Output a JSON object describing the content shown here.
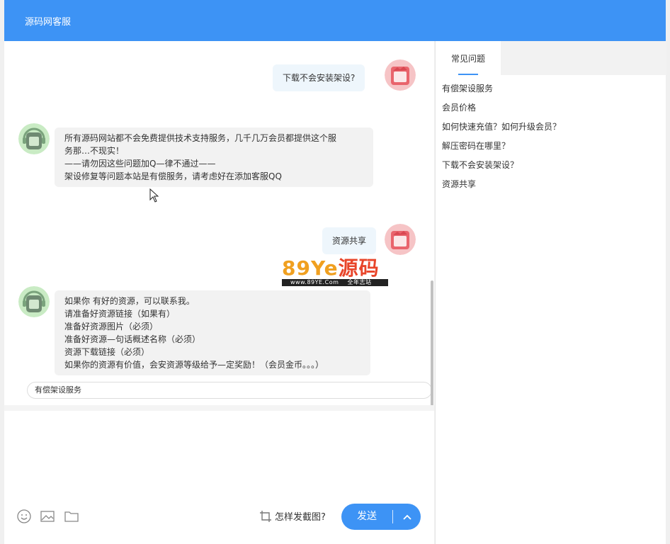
{
  "window": {
    "title": "源码网客服"
  },
  "messages": [
    {
      "side": "right",
      "lines": [
        "下载不会安装架设?"
      ]
    },
    {
      "side": "left",
      "lines": [
        "所有源码网站都不会免费提供技术支持服务，几千几万会员都提供这个服",
        "务那…不现实！",
        "——请勿因这些问题加Q—律不通过——",
        "架设修复等问题本站是有偿服务，请考虑好在添加客服QQ"
      ]
    },
    {
      "side": "right",
      "lines": [
        "资源共享"
      ]
    },
    {
      "side": "left",
      "lines": [
        "如果你 有好的资源，可以联系我。",
        "请准备好资源链接（如果有）",
        "准备好资源图片（必须）",
        "准备好资源—句话概述名称（必须）",
        "资源下载链接（必须）",
        "如果你的资源有价值，会安资源等级给予—定奖励！（会员金币。。。）"
      ]
    }
  ],
  "watermark": {
    "main": "89Ye",
    "main_cn": "源码",
    "sub": "www.89YE.Com",
    "sub_cn": "全年志站"
  },
  "quick_reply": "有偿架设服务",
  "toolbar": {
    "icons": [
      "smile-icon",
      "image-icon",
      "folder-icon"
    ],
    "screenshot_tip": "怎样发截图?",
    "send_label": "发送"
  },
  "sidepanel": {
    "tab": "常见问题",
    "faq": [
      "有偿架设服务",
      "会员价格",
      "如何快速充值？如何升级会员？",
      "解压密码在哪里？",
      "下载不会安装架设？",
      "资源共享"
    ]
  },
  "colors": {
    "primary": "#3d93f5",
    "agent_avatar": "#a8dba0",
    "user_avatar": "#f2a0a4"
  }
}
